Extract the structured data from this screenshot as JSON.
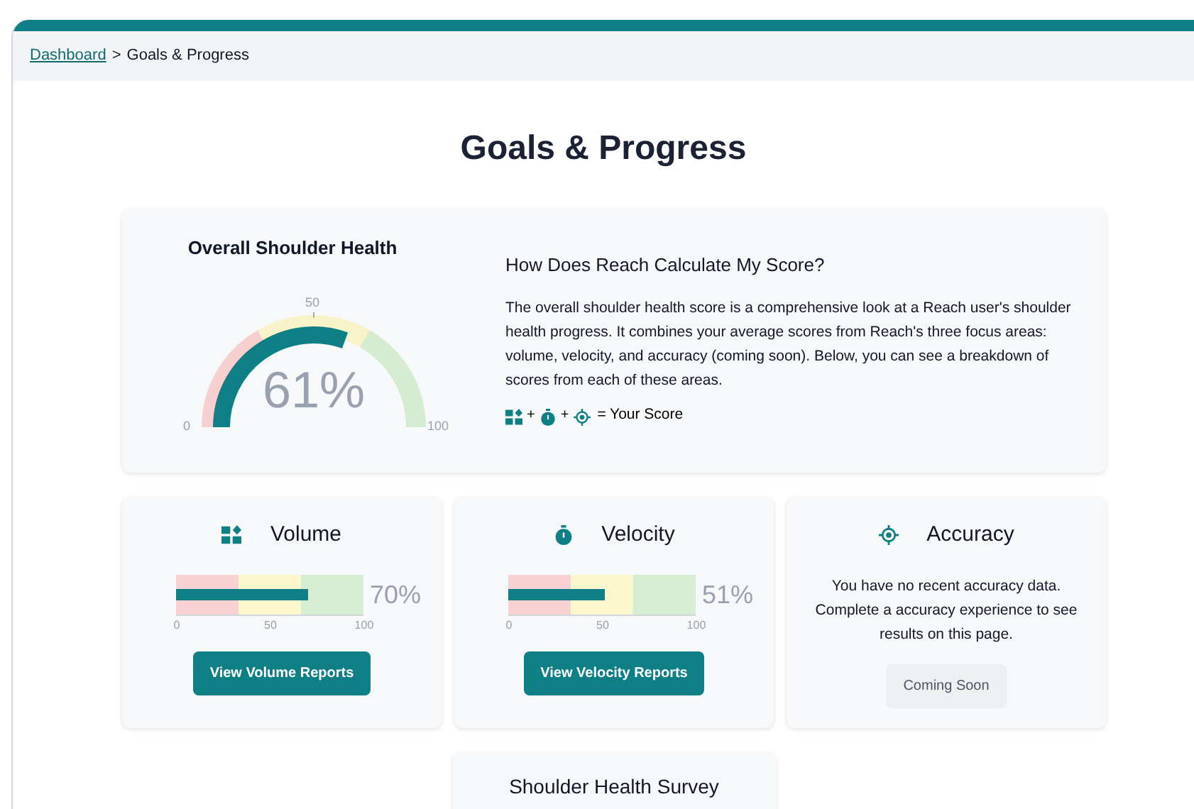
{
  "breadcrumb": {
    "link": "Dashboard",
    "separator": ">",
    "current": "Goals & Progress"
  },
  "title": "Goals & Progress",
  "overall": {
    "title": "Overall Shoulder Health",
    "gauge": {
      "value": "61%",
      "min": "0",
      "mid": "50",
      "max": "100"
    },
    "info": {
      "heading": "How Does Reach Calculate My Score?",
      "body": "The overall shoulder health score is a comprehensive look at a Reach user's shoulder health progress. It combines your average scores from Reach's three focus areas: volume, velocity, and accuracy (coming soon). Below, you can see a breakdown of scores from each of these areas.",
      "plus": [
        "+",
        "+"
      ],
      "result": "= Your Score"
    }
  },
  "areas": [
    {
      "kind": "bar",
      "title": "Volume",
      "level": 0.7,
      "value": "70%",
      "ticks": [
        "0",
        "50",
        "100"
      ],
      "button": "View Volume Reports"
    },
    {
      "kind": "bar",
      "title": "Velocity",
      "level": 0.51,
      "value": "51%",
      "ticks": [
        "0",
        "50",
        "100"
      ],
      "button": "View Velocity Reports"
    },
    {
      "kind": "message",
      "title": "Accuracy",
      "message": "You have no recent accuracy data. Complete a accuracy experience to see results on this page.",
      "button": "Coming Soon",
      "disabled": true
    }
  ],
  "survey": {
    "title": "Shoulder Health Survey"
  }
}
